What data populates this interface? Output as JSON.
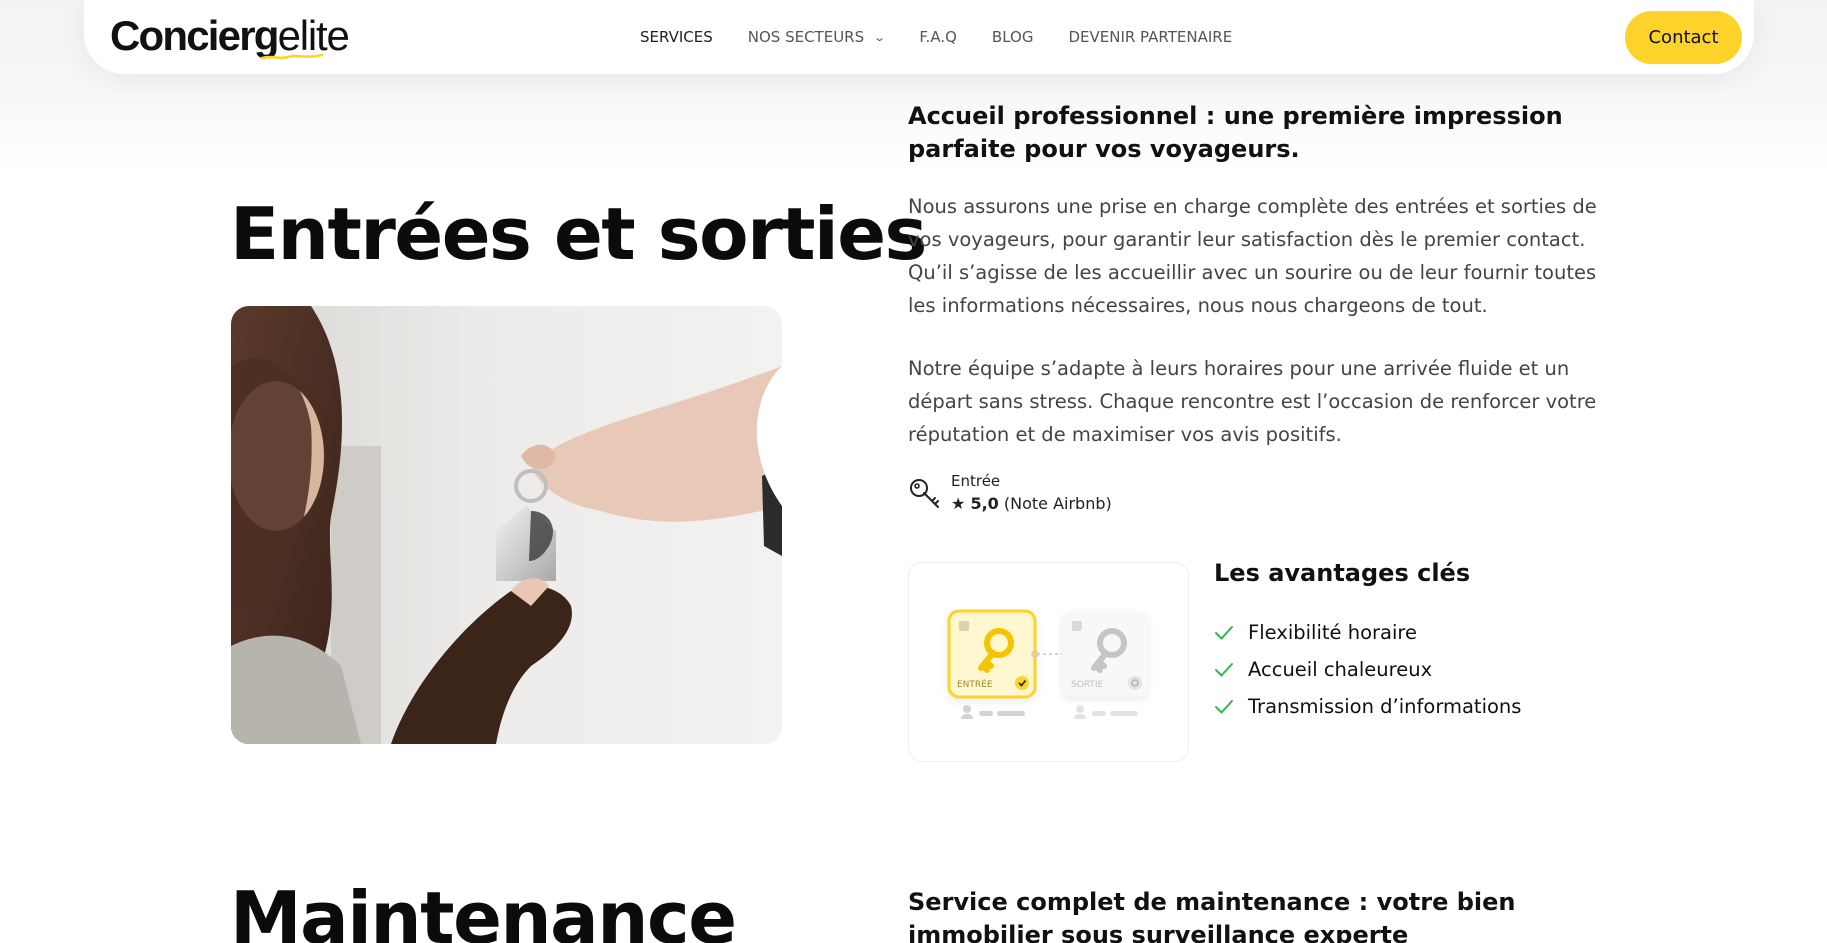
{
  "logo": {
    "bold": "Concierg",
    "thin": "elite"
  },
  "nav": {
    "items": [
      {
        "label": "SERVICES"
      },
      {
        "label": "NOS SECTEURS"
      },
      {
        "label": "F.A.Q"
      },
      {
        "label": "BLOG"
      },
      {
        "label": "DEVENIR PARTENAIRE"
      }
    ],
    "contact_label": "Contact"
  },
  "colors": {
    "accent": "#fdd22b",
    "check": "#2db84d"
  },
  "section1": {
    "title": "Entrées et sorties",
    "subheading": "Accueil professionnel : une première impression parfaite pour vos voyageurs.",
    "paragraphs": [
      "Nous assurons une prise en charge complète des entrées et sorties de vos voyageurs, pour garantir leur satisfaction dès le premier contact. Qu’il s’agisse de les accueillir avec un sourire ou de leur fournir toutes les informations nécessaires, nous nous chargeons de tout.",
      "Notre équipe s’adapte à leurs horaires pour une arrivée fluide et un départ sans stress. Chaque rencontre est l’occasion de renforcer votre réputation et de maximiser vos avis positifs."
    ],
    "rating": {
      "label": "Entrée",
      "star": "★",
      "score": "5,0",
      "note": "(Note Airbnb)"
    },
    "card": {
      "entry_label": "ENTRÉE",
      "exit_label": "SORTIE"
    },
    "advantages": {
      "title": "Les avantages clés",
      "items": [
        "Flexibilité horaire",
        "Accueil chaleureux",
        "Transmission d’informations"
      ]
    }
  },
  "section2": {
    "title": "Maintenance",
    "subheading": "Service complet de maintenance : votre bien immobilier sous surveillance experte"
  }
}
